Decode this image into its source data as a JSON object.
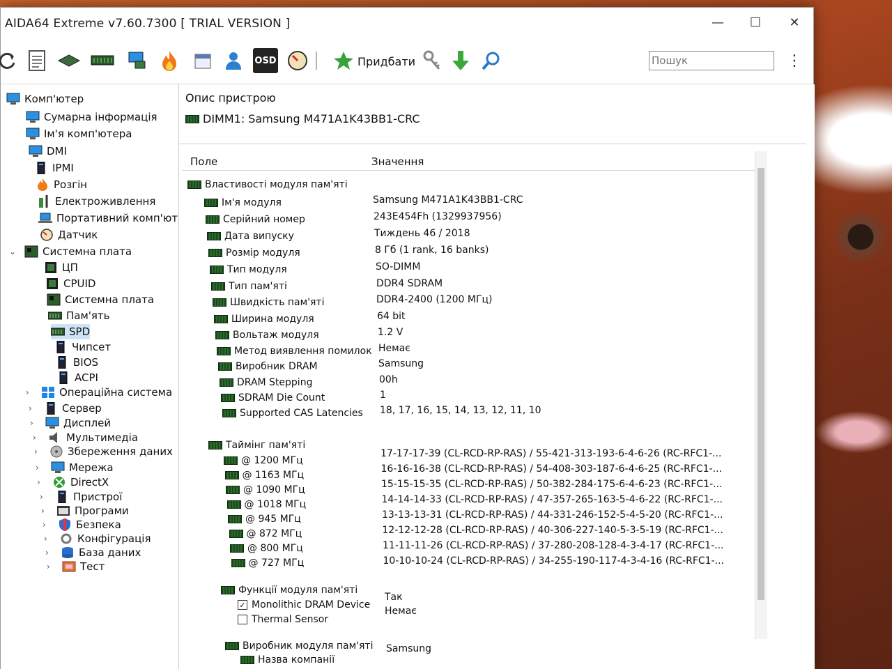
{
  "window": {
    "title": "AIDA64 Extreme v7.60.7300  [ TRIAL VERSION ]"
  },
  "controls": {
    "minimize": "—",
    "maximize": "☐",
    "close": "✕"
  },
  "toolbar": {
    "add_label": "Придбати",
    "search_placeholder": "Пошук",
    "more": "⋮",
    "icons": [
      "refresh-icon",
      "report-icon",
      "motherboard-icon",
      "memory-icon",
      "network-computer-icon",
      "flame-icon",
      "calendar-icon",
      "user-icon",
      "osd-icon",
      "gauge-icon",
      "add-icon",
      "key-icon",
      "download-icon",
      "search-icon"
    ],
    "osd_text": "OSD"
  },
  "tree": {
    "items": [
      {
        "label": "Комп'ютер"
      },
      {
        "label": "Сумарна інформація"
      },
      {
        "label": "Ім'я комп'ютера"
      },
      {
        "label": "DMI"
      },
      {
        "label": "IPMI"
      },
      {
        "label": "Розгін"
      },
      {
        "label": "Електроживлення"
      },
      {
        "label": "Портативний комп'ютер"
      },
      {
        "label": "Датчик"
      },
      {
        "label": "Системна плата"
      },
      {
        "label": "ЦП"
      },
      {
        "label": "CPUID"
      },
      {
        "label": "Системна плата"
      },
      {
        "label": "Пам'ять"
      },
      {
        "label": "SPD"
      },
      {
        "label": "Чипсет"
      },
      {
        "label": "BIOS"
      },
      {
        "label": "ACPI"
      },
      {
        "label": "Операційна система"
      },
      {
        "label": "Сервер"
      },
      {
        "label": "Дисплей"
      },
      {
        "label": "Мультимедіа"
      },
      {
        "label": "Збереження даних"
      },
      {
        "label": "Мережа"
      },
      {
        "label": "DirectX"
      },
      {
        "label": "Пристрої"
      },
      {
        "label": "Програми"
      },
      {
        "label": "Безпека"
      },
      {
        "label": "Конфігурація"
      },
      {
        "label": "База даних"
      },
      {
        "label": "Тест"
      }
    ],
    "expanded_glyph": "⌄",
    "collapsed_glyph": "›"
  },
  "device": {
    "section_title": "Опис пристрою",
    "name": "DIMM1: Samsung M471A1K43BB1-CRC"
  },
  "columns": {
    "field": "Поле",
    "value": "Значення"
  },
  "groups": {
    "module_props": "Властивості модуля пам'яті",
    "timings": "Таймінг пам'яті",
    "features": "Функції модуля пам'яті",
    "manufacturer": "Виробник модуля пам'яті"
  },
  "props": [
    {
      "field": "Ім'я модуля",
      "value": "Samsung M471A1K43BB1-CRC"
    },
    {
      "field": "Серійний номер",
      "value": "243E454Fh (1329937956)"
    },
    {
      "field": "Дата випуску",
      "value": "Тиждень 46 / 2018"
    },
    {
      "field": "Розмір модуля",
      "value": "8 Гб (1 rank, 16 banks)"
    },
    {
      "field": "Тип модуля",
      "value": "SO-DIMM"
    },
    {
      "field": "Тип пам'яті",
      "value": "DDR4 SDRAM"
    },
    {
      "field": "Швидкість пам'яті",
      "value": "DDR4-2400 (1200 МГц)"
    },
    {
      "field": "Ширина модуля",
      "value": "64 bit"
    },
    {
      "field": "Вольтаж модуля",
      "value": "1.2 V"
    },
    {
      "field": "Метод виявлення помилок",
      "value": "Немає"
    },
    {
      "field": "Виробник DRAM",
      "value": "Samsung"
    },
    {
      "field": "DRAM Stepping",
      "value": "00h"
    },
    {
      "field": "SDRAM Die Count",
      "value": "1"
    },
    {
      "field": "Supported CAS Latencies",
      "value": "18, 17, 16, 15, 14, 13, 12, 11, 10"
    }
  ],
  "timings": [
    {
      "field": "@ 1200 МГц",
      "value": "17-17-17-39  (CL-RCD-RP-RAS) / 55-421-313-193-6-4-6-26  (RC-RFC1-..."
    },
    {
      "field": "@ 1163 МГц",
      "value": "16-16-16-38  (CL-RCD-RP-RAS) / 54-408-303-187-6-4-6-25  (RC-RFC1-..."
    },
    {
      "field": "@ 1090 МГц",
      "value": "15-15-15-35  (CL-RCD-RP-RAS) / 50-382-284-175-6-4-6-23  (RC-RFC1-..."
    },
    {
      "field": "@ 1018 МГц",
      "value": "14-14-14-33  (CL-RCD-RP-RAS) / 47-357-265-163-5-4-6-22  (RC-RFC1-..."
    },
    {
      "field": "@ 945 МГц",
      "value": "13-13-13-31  (CL-RCD-RP-RAS) / 44-331-246-152-5-4-5-20  (RC-RFC1-..."
    },
    {
      "field": "@ 872 МГц",
      "value": "12-12-12-28  (CL-RCD-RP-RAS) / 40-306-227-140-5-3-5-19  (RC-RFC1-..."
    },
    {
      "field": "@ 800 МГц",
      "value": "11-11-11-26  (CL-RCD-RP-RAS) / 37-280-208-128-4-3-4-17  (RC-RFC1-..."
    },
    {
      "field": "@ 727 МГц",
      "value": "10-10-10-24  (CL-RCD-RP-RAS) / 34-255-190-117-4-3-4-16  (RC-RFC1-..."
    }
  ],
  "features": [
    {
      "field": "Monolithic DRAM Device",
      "value": "Так",
      "checked": true
    },
    {
      "field": "Thermal Sensor",
      "value": "Немає",
      "checked": false
    }
  ],
  "manufacturer": [
    {
      "field": "Назва компанії",
      "value": "Samsung"
    }
  ],
  "checkmark": "✓"
}
